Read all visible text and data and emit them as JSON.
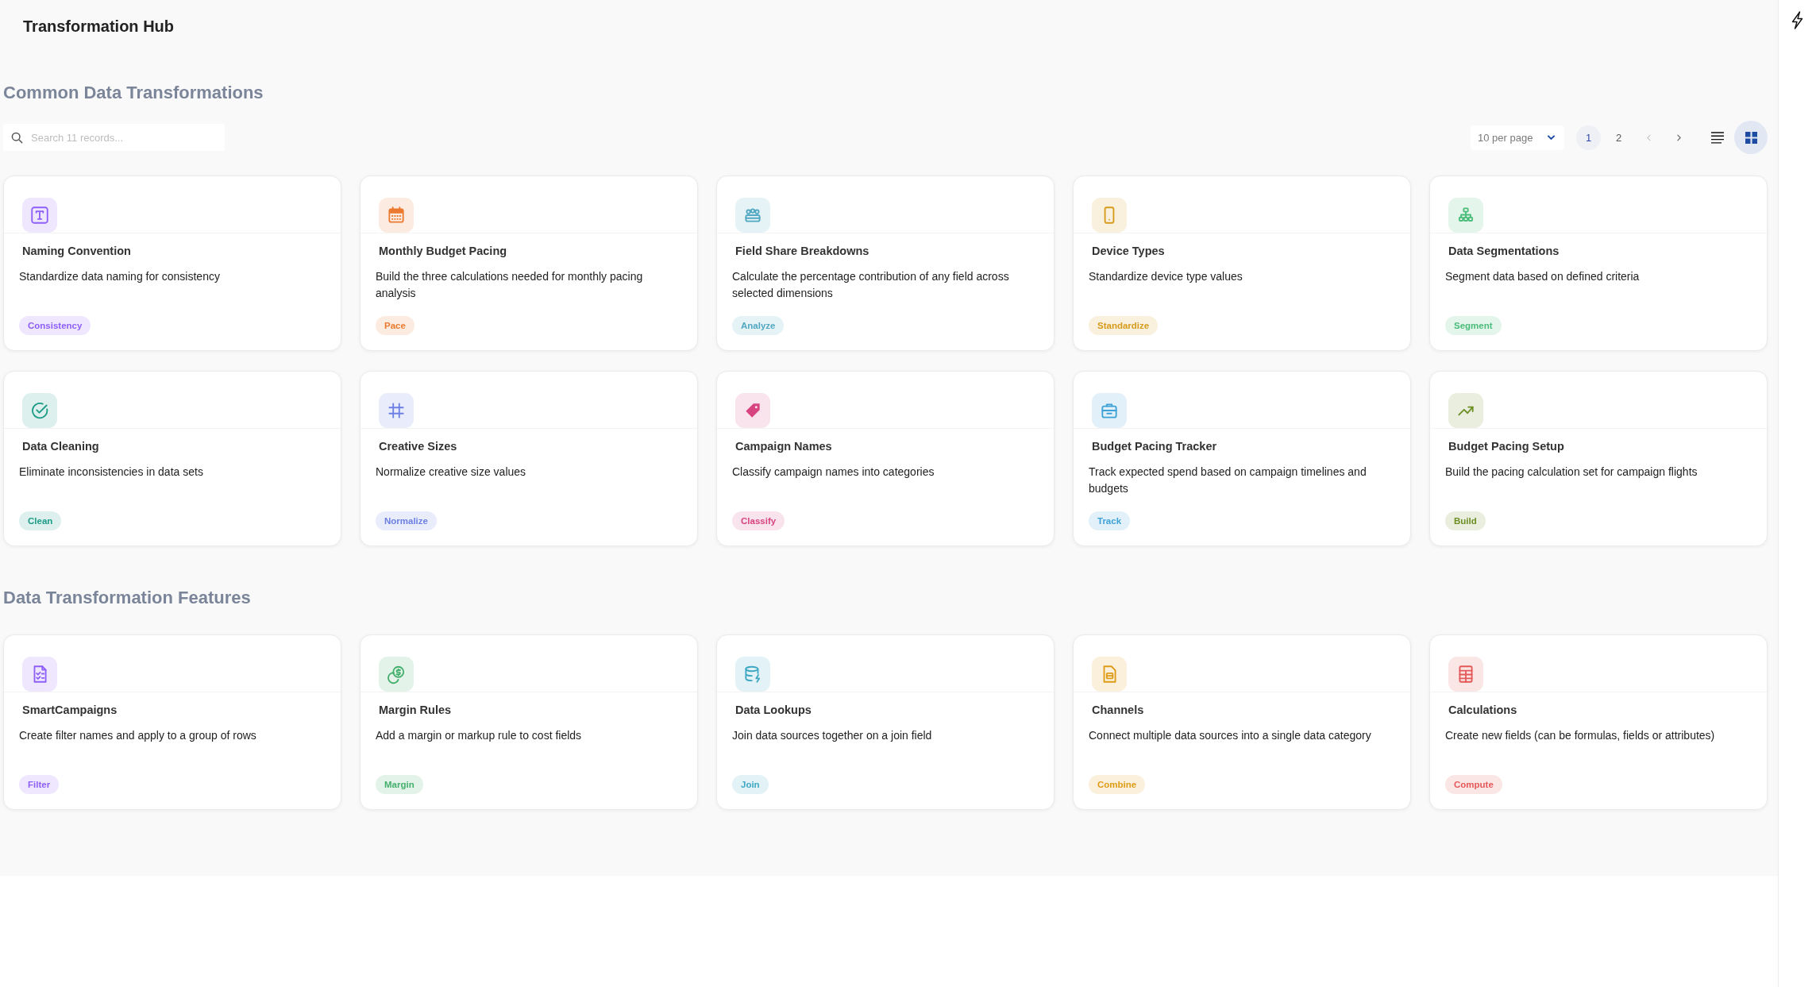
{
  "page_title": "Transformation Hub",
  "sections": [
    {
      "title": "Common Data Transformations",
      "toolbar": {
        "search": {
          "placeholder": "Search 11 records..."
        },
        "per_page": "10 per page",
        "pages": [
          {
            "label": "1",
            "selected": true
          },
          {
            "label": "2",
            "selected": false
          }
        ],
        "prev_button": {
          "disabled": true
        },
        "next_button": {
          "disabled": false
        },
        "views": [
          {
            "kind": "list",
            "selected": false
          },
          {
            "kind": "grid",
            "selected": true
          }
        ]
      },
      "cards": [
        {
          "title": "Naming Convention",
          "description": "Standardize data naming for consistency",
          "tag": "Consistency",
          "color": "#eee7fe"
        },
        {
          "title": "Monthly Budget Pacing",
          "description": "Build the three calculations needed for monthly pacing analysis",
          "tag": "Pace",
          "color": "#fcebe0"
        },
        {
          "title": "Field Share Breakdowns",
          "description": "Calculate the percentage contribution of any field across selected dimensions",
          "tag": "Analyze",
          "color": "#e5f2f6"
        },
        {
          "title": "Device Types",
          "description": "Standardize device type values",
          "tag": "Standardize",
          "color": "#f9f0dd"
        },
        {
          "title": "Data Segmentations",
          "description": "Segment data based on defined criteria",
          "tag": "Segment",
          "color": "#e4f5eb"
        },
        {
          "title": "Data Cleaning",
          "description": "Eliminate inconsistencies in data sets",
          "tag": "Clean",
          "color": "#ddf0ed"
        },
        {
          "title": "Creative Sizes",
          "description": "Normalize creative size values",
          "tag": "Normalize",
          "color": "#e9ecfb"
        },
        {
          "title": "Campaign Names",
          "description": "Classify campaign names into categories",
          "tag": "Classify",
          "color": "#f9e3ec"
        },
        {
          "title": "Budget Pacing Tracker",
          "description": "Track expected spend based on campaign timelines and budgets",
          "tag": "Track",
          "color": "#e2f1f9"
        },
        {
          "title": "Budget Pacing Setup",
          "description": "Build the pacing calculation set for campaign flights",
          "tag": "Build",
          "color": "#e9eede"
        }
      ]
    },
    {
      "title": "Data Transformation Features",
      "cards": [
        {
          "title": "SmartCampaigns",
          "description": "Create filter names and apply to a group of rows",
          "tag": "Filter",
          "color": "#eee7fe"
        },
        {
          "title": "Margin Rules",
          "description": "Add a margin or markup rule to cost fields",
          "tag": "Margin",
          "color": "#e3f3e9"
        },
        {
          "title": "Data Lookups",
          "description": "Join data sources together on a join field",
          "tag": "Join",
          "color": "#e2f2f6"
        },
        {
          "title": "Channels",
          "description": "Connect multiple data sources into a single data category",
          "tag": "Combine",
          "color": "#faf0dc"
        },
        {
          "title": "Calculations",
          "description": "Create new fields (can be formulas, fields or attributes)",
          "tag": "Compute",
          "color": "#fbe6e6"
        }
      ]
    }
  ]
}
